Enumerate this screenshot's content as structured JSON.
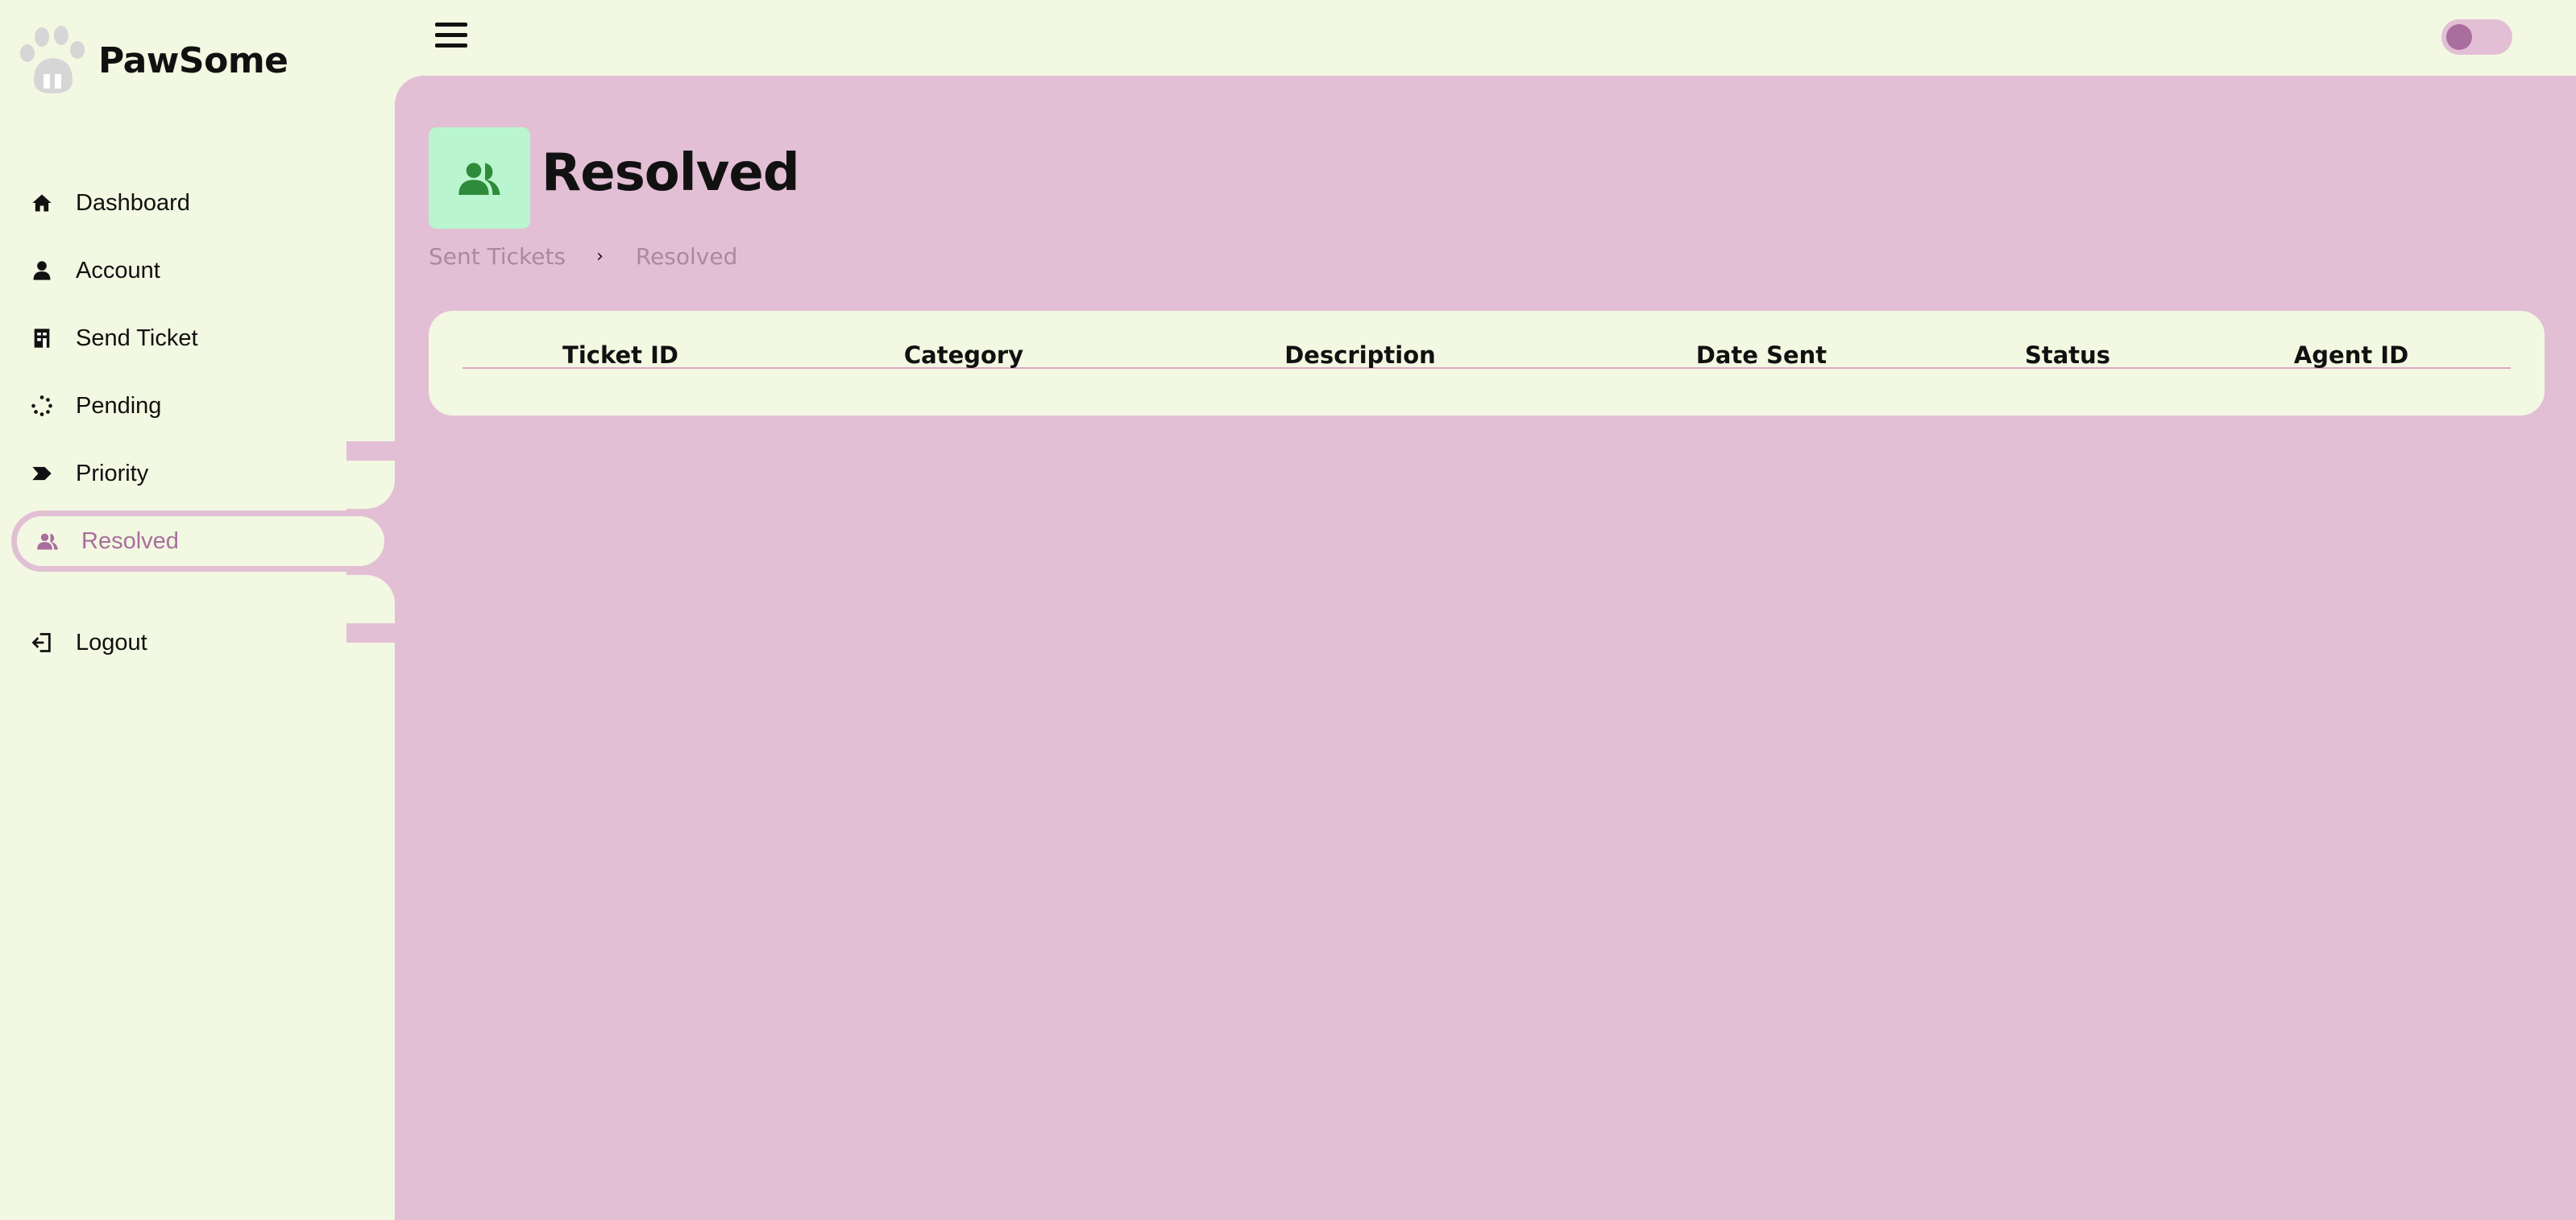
{
  "brand": {
    "name": "PawSome",
    "logo_icon": "paw-logo-icon"
  },
  "topbar": {
    "menu_icon": "hamburger-icon",
    "theme_toggle": {
      "state": "off"
    }
  },
  "sidebar": {
    "items": [
      {
        "label": "Dashboard",
        "icon": "home-icon"
      },
      {
        "label": "Account",
        "icon": "user-icon"
      },
      {
        "label": "Send Ticket",
        "icon": "ticket-icon"
      },
      {
        "label": "Pending",
        "icon": "spinner-icon"
      },
      {
        "label": "Priority",
        "icon": "priority-tag-icon"
      },
      {
        "label": "Resolved",
        "icon": "users-icon",
        "active": true
      },
      {
        "label": "Logout",
        "icon": "logout-icon"
      }
    ]
  },
  "page": {
    "title": "Resolved",
    "icon": "users-icon",
    "breadcrumb": {
      "parent": "Sent Tickets",
      "separator": "›",
      "current": "Resolved"
    }
  },
  "table": {
    "columns": [
      "Ticket ID",
      "Category",
      "Description",
      "Date Sent",
      "Status",
      "Agent ID"
    ],
    "rows": []
  },
  "colors": {
    "background": "#f2f8e1",
    "panel": "#e2bfd5",
    "accent": "#a96e9d",
    "icon_tile": "#b9f5cf",
    "icon_green": "#2e8b3a"
  }
}
